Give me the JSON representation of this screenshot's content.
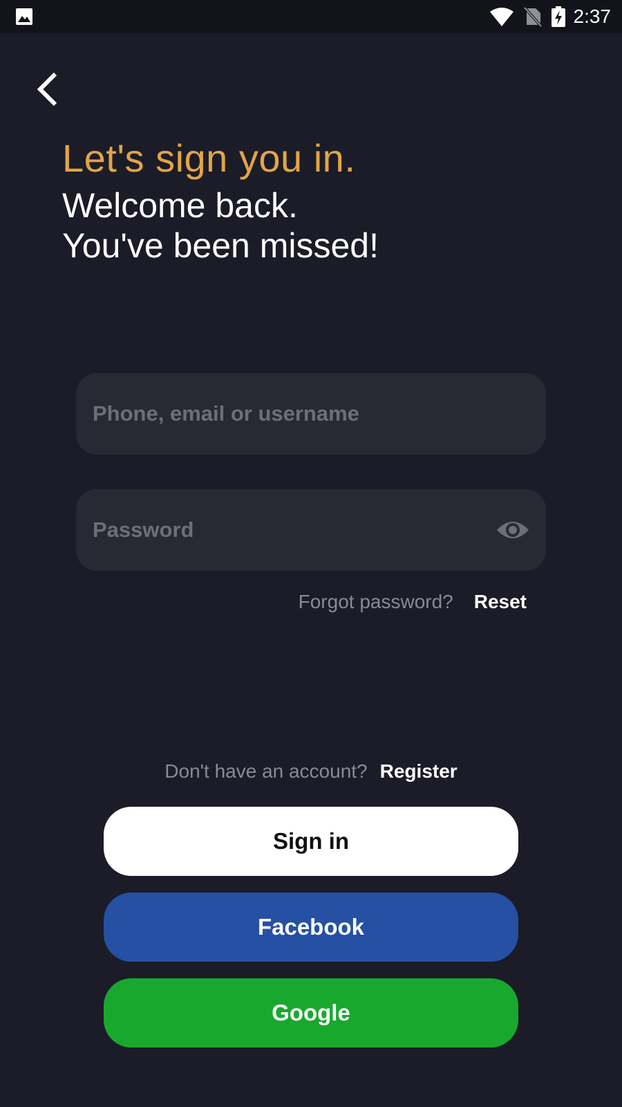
{
  "status_bar": {
    "time": "2:37",
    "icons": [
      "gallery-icon",
      "wifi-icon",
      "no-sim-icon",
      "battery-charging-icon"
    ]
  },
  "nav": {
    "back_icon": "chevron-left-icon"
  },
  "header": {
    "headline": "Let's sign you in.",
    "welcome_line1": "Welcome back.",
    "welcome_line2": "You've been missed!"
  },
  "form": {
    "username_value": "",
    "username_placeholder": "Phone, email or username",
    "password_value": "",
    "password_placeholder": "Password",
    "toggle_visibility_icon": "eye-icon",
    "forgot_text": "Forgot password?",
    "reset_label": "Reset"
  },
  "footer": {
    "no_account_text": "Don't have an account?",
    "register_label": "Register",
    "signin_label": "Sign in",
    "facebook_label": "Facebook",
    "google_label": "Google"
  },
  "colors": {
    "background": "#1b1c27",
    "status_bar": "#12131b",
    "accent": "#e3a446",
    "field_bg": "#282a33",
    "placeholder": "#6e6f75",
    "muted_text": "#8a8b91",
    "signin_bg": "#ffffff",
    "facebook_bg": "#2550a4",
    "google_bg": "#19a82e"
  }
}
